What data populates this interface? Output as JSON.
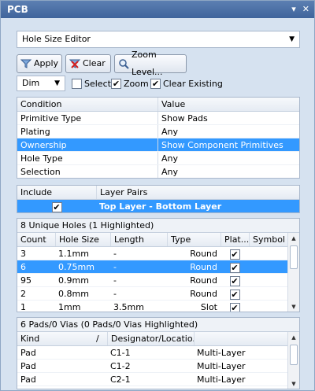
{
  "panel": {
    "title": "PCB",
    "pin_icon": "▾",
    "close_icon": "✕"
  },
  "editor_select": {
    "value": "Hole Size Editor"
  },
  "toolbar": {
    "apply_label": "Apply",
    "clear_label": "Clear",
    "zoom_level_label": "Zoom Level..."
  },
  "mode_select": {
    "value": "Dim"
  },
  "options": {
    "select_label": "Select",
    "zoom_label": "Zoom",
    "clear_existing_label": "Clear Existing",
    "select_checked": false,
    "zoom_checked": true,
    "clear_existing_checked": true
  },
  "conditions": {
    "columns": [
      "Condition",
      "Value"
    ],
    "rows": [
      [
        "Primitive Type",
        "Show Pads"
      ],
      [
        "Plating",
        "Any"
      ],
      [
        "Ownership",
        "Show Component Primitives"
      ],
      [
        "Hole Type",
        "Any"
      ],
      [
        "Selection",
        "Any"
      ]
    ],
    "selected_index": 2
  },
  "layers": {
    "columns": [
      "Include",
      "Layer Pairs"
    ],
    "rows": [
      {
        "include": true,
        "pair": "Top Layer - Bottom Layer"
      }
    ]
  },
  "holes": {
    "caption": "8 Unique Holes (1 Highlighted)",
    "columns": [
      "Count",
      "Hole Size",
      "Length",
      "Type",
      "Plat...",
      "Symbol"
    ],
    "rows": [
      [
        "3",
        "1.1mm",
        "-",
        "Round",
        true,
        ""
      ],
      [
        "6",
        "0.75mm",
        "-",
        "Round",
        true,
        ""
      ],
      [
        "95",
        "0.9mm",
        "-",
        "Round",
        true,
        ""
      ],
      [
        "2",
        "0.8mm",
        "-",
        "Round",
        true,
        ""
      ],
      [
        "1",
        "1mm",
        "3.5mm",
        "Slot",
        true,
        ""
      ]
    ],
    "selected_index": 1
  },
  "pads": {
    "caption": "6 Pads/0 Vias (0 Pads/0 Vias Highlighted)",
    "columns": [
      "Kind",
      "Designator/Locatio..."
    ],
    "sort_mark": "/",
    "rows": [
      [
        "Pad",
        "C1-1",
        "Multi-Layer"
      ],
      [
        "Pad",
        "C1-2",
        "Multi-Layer"
      ],
      [
        "Pad",
        "C2-1",
        "Multi-Layer"
      ]
    ]
  }
}
